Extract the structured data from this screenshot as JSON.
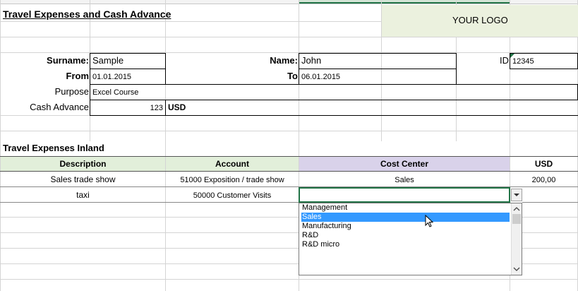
{
  "sheet": {
    "title": "Travel Expenses and Cash Advance",
    "logo_text": "YOUR LOGO"
  },
  "form": {
    "surname_label": "Surname:",
    "surname_value": "Sample",
    "name_label": "Name:",
    "name_value": "John",
    "id_label": "ID",
    "id_value": "12345",
    "from_label": "From",
    "from_value": "01.01.2015",
    "to_label": "To",
    "to_value": "06.01.2015",
    "purpose_label": "Purpose",
    "purpose_value": "Excel Course",
    "cash_advance_label": "Cash Advance",
    "cash_advance_value": "123",
    "currency": "USD"
  },
  "table": {
    "section_title": "Travel Expenses Inland",
    "headers": [
      "Description",
      "Account",
      "Cost Center",
      "USD"
    ],
    "rows": [
      {
        "description": "Sales trade show",
        "account": "51000 Exposition / trade show",
        "cost_center": "Sales",
        "usd": "200,00"
      },
      {
        "description": "taxi",
        "account": "50000 Customer Visits",
        "cost_center": "",
        "usd": ""
      }
    ]
  },
  "dropdown": {
    "options": [
      "Management",
      "Sales",
      "Manufacturing",
      "R&D",
      "R&D micro"
    ],
    "selected_index": 1
  },
  "colors": {
    "header_green": "#e2efda",
    "header_purple": "#d9d2ea",
    "logo_bg": "#ebf1de",
    "selection_blue": "#3399ff",
    "active_cell_green": "#217346"
  },
  "icons": {
    "dropdown_arrow": "chevron-down-icon",
    "scroll_up": "chevron-up-icon",
    "scroll_down": "chevron-down-icon",
    "cursor": "mouse-pointer-icon"
  }
}
